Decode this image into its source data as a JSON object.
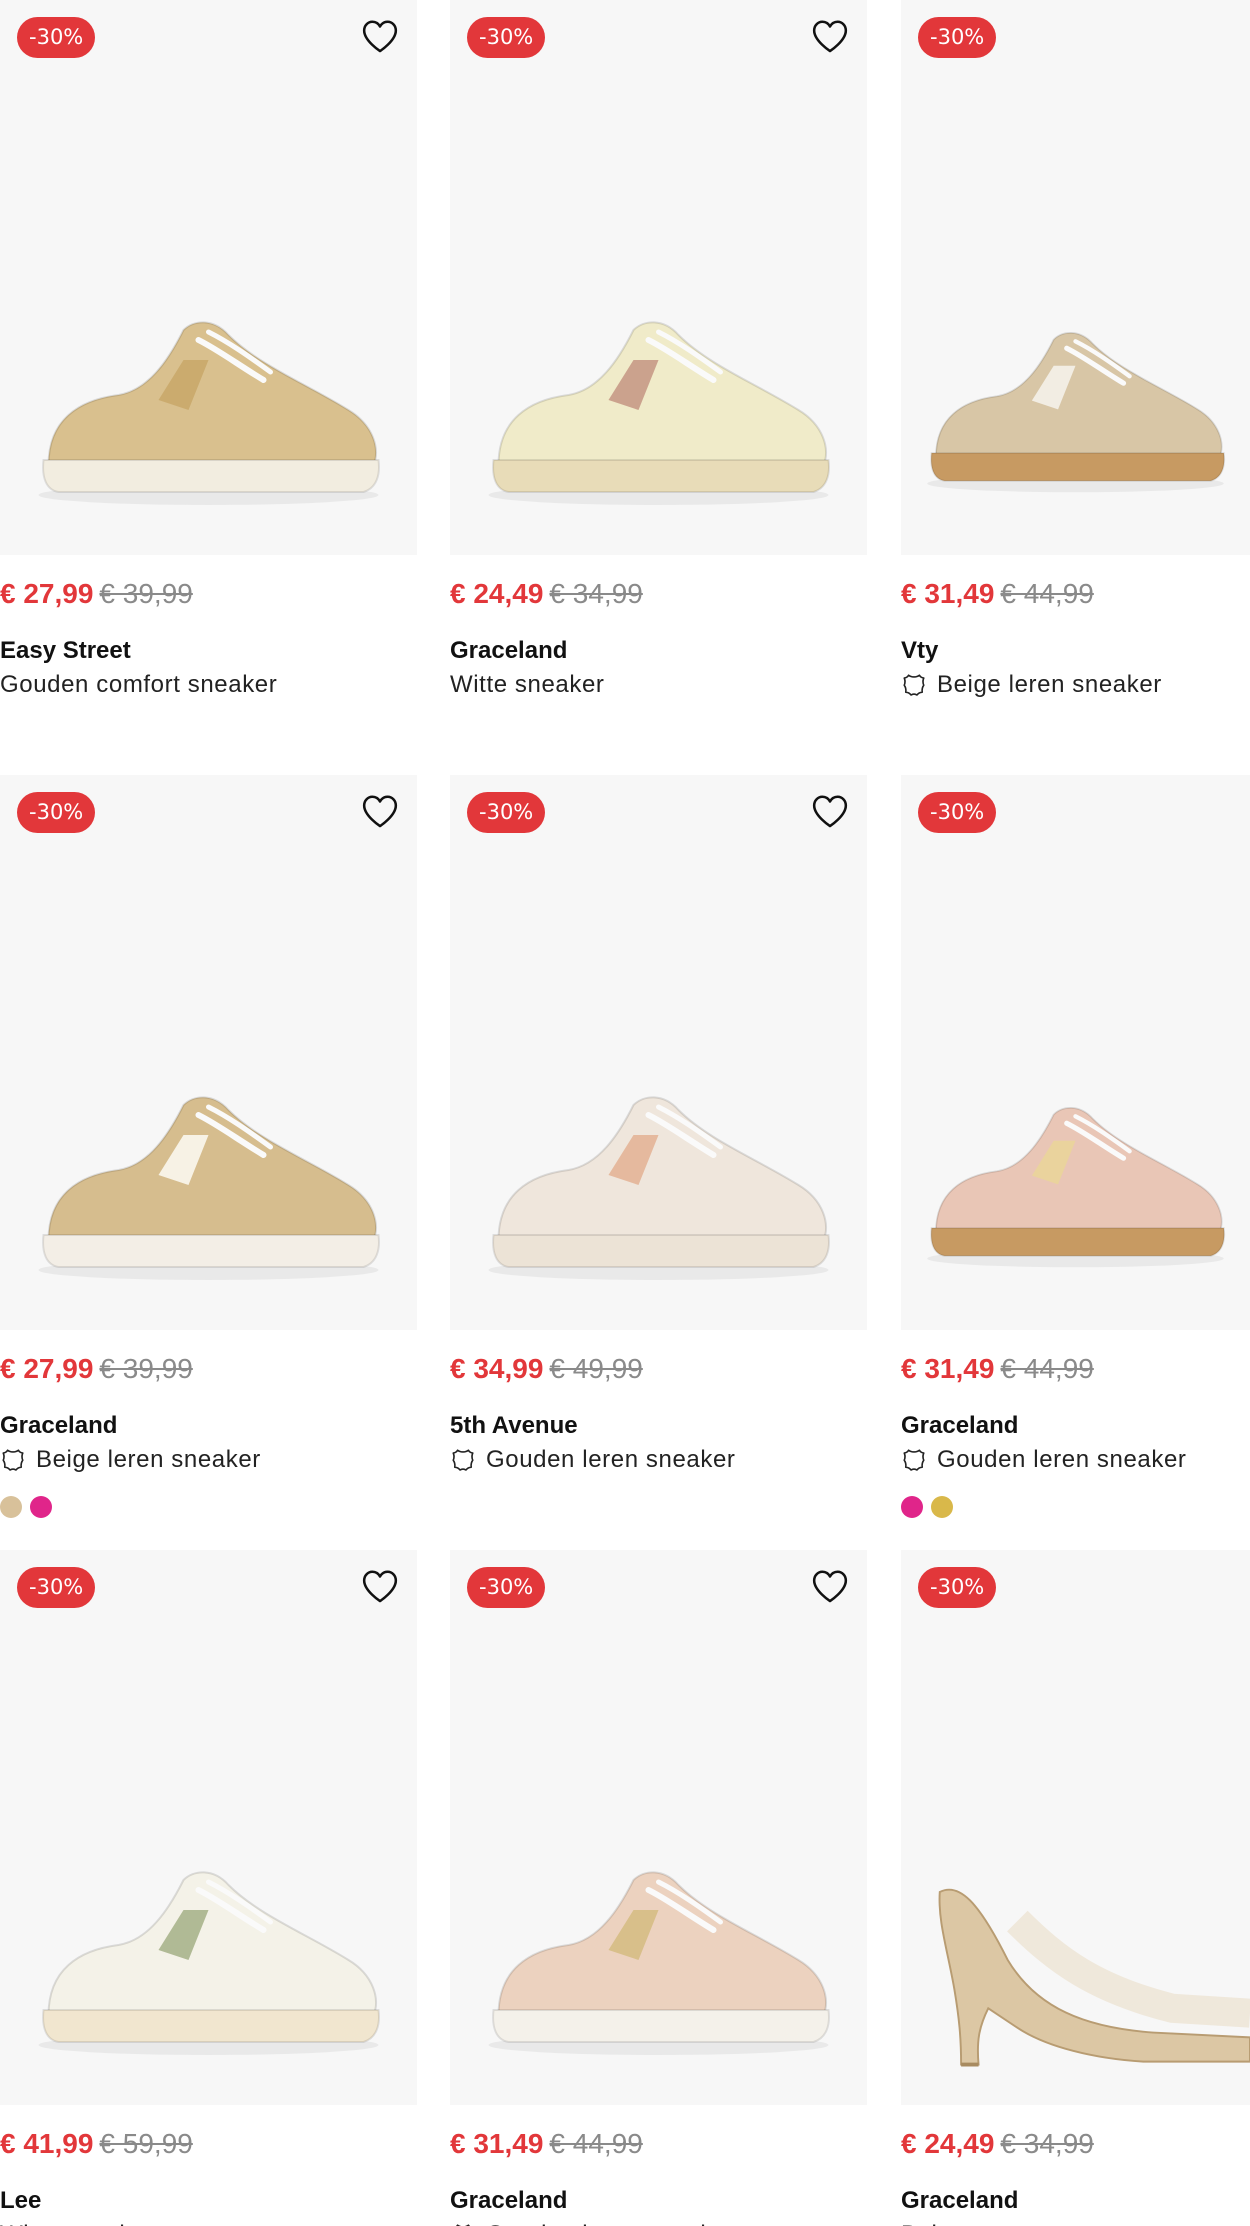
{
  "products": [
    {
      "discount": "-30%",
      "price": "€ 27,99",
      "old_price": "€ 39,99",
      "brand": "Easy Street",
      "name": "Gouden comfort sneaker",
      "leather": false,
      "swatches": [],
      "shoe": "sneaker-gold",
      "colors": {
        "upper": "#d9c08e",
        "sole": "#f2ede0",
        "accent": "#c9a96a"
      }
    },
    {
      "discount": "-30%",
      "price": "€ 24,49",
      "old_price": "€ 34,99",
      "brand": "Graceland",
      "name": "Witte sneaker",
      "leather": false,
      "swatches": [],
      "shoe": "sneaker-pastel",
      "colors": {
        "upper": "#f0ebc9",
        "sole": "#e8dcb8",
        "accent": "#c79a86"
      }
    },
    {
      "discount": "-30%",
      "price": "€ 31,49",
      "old_price": "€ 44,99",
      "brand": "Vty",
      "name": "Beige leren sneaker",
      "leather": true,
      "swatches": [],
      "shoe": "sneaker-beige",
      "colors": {
        "upper": "#d8c6a6",
        "sole": "#c79a62",
        "accent": "#f5f1ea"
      }
    },
    {
      "discount": "-30%",
      "price": "€ 27,99",
      "old_price": "€ 39,99",
      "brand": "Graceland",
      "name": "Beige leren sneaker",
      "leather": true,
      "swatches": [
        "#d8c19a",
        "#e0258a"
      ],
      "shoe": "sneaker-tan",
      "colors": {
        "upper": "#d6bd8e",
        "sole": "#f3eee6",
        "accent": "#fbf7ee"
      }
    },
    {
      "discount": "-30%",
      "price": "€ 34,99",
      "old_price": "€ 49,99",
      "brand": "5th Avenue",
      "name": "Gouden leren sneaker",
      "leather": true,
      "swatches": [],
      "shoe": "sneaker-rose",
      "colors": {
        "upper": "#efe6dc",
        "sole": "#ece3d6",
        "accent": "#e3b497"
      }
    },
    {
      "discount": "-30%",
      "price": "€ 31,49",
      "old_price": "€ 44,99",
      "brand": "Graceland",
      "name": "Gouden leren sneaker",
      "leather": true,
      "swatches": [
        "#e0258a",
        "#d9b84a"
      ],
      "shoe": "sneaker-pink",
      "colors": {
        "upper": "#e9c6b6",
        "sole": "#c79a62",
        "accent": "#ead49a"
      }
    },
    {
      "discount": "-30%",
      "price": "€ 41,99",
      "old_price": "€ 59,99",
      "brand": "Lee",
      "name": "Witte sneaker",
      "leather": false,
      "swatches": [],
      "shoe": "sneaker-white",
      "colors": {
        "upper": "#f4f2e8",
        "sole": "#f1e6cf",
        "accent": "#a8b48c"
      }
    },
    {
      "discount": "-30%",
      "price": "€ 31,49",
      "old_price": "€ 44,99",
      "brand": "Graceland",
      "name": "Gouden leren sneaker",
      "leather": true,
      "swatches": [],
      "shoe": "sneaker-mix",
      "colors": {
        "upper": "#ecd2bf",
        "sole": "#f4f1ea",
        "accent": "#d6bc84"
      }
    },
    {
      "discount": "-30%",
      "price": "€ 24,49",
      "old_price": "€ 34,99",
      "brand": "Graceland",
      "name": "Beige pump",
      "leather": false,
      "swatches": [],
      "shoe": "pump",
      "colors": {
        "upper": "#dcc7a4",
        "sole": "#cdb38b",
        "accent": "#e9dcc4"
      }
    }
  ],
  "icons": {
    "favorite": "heart-outline-icon",
    "leather": "leather-hide-icon"
  }
}
